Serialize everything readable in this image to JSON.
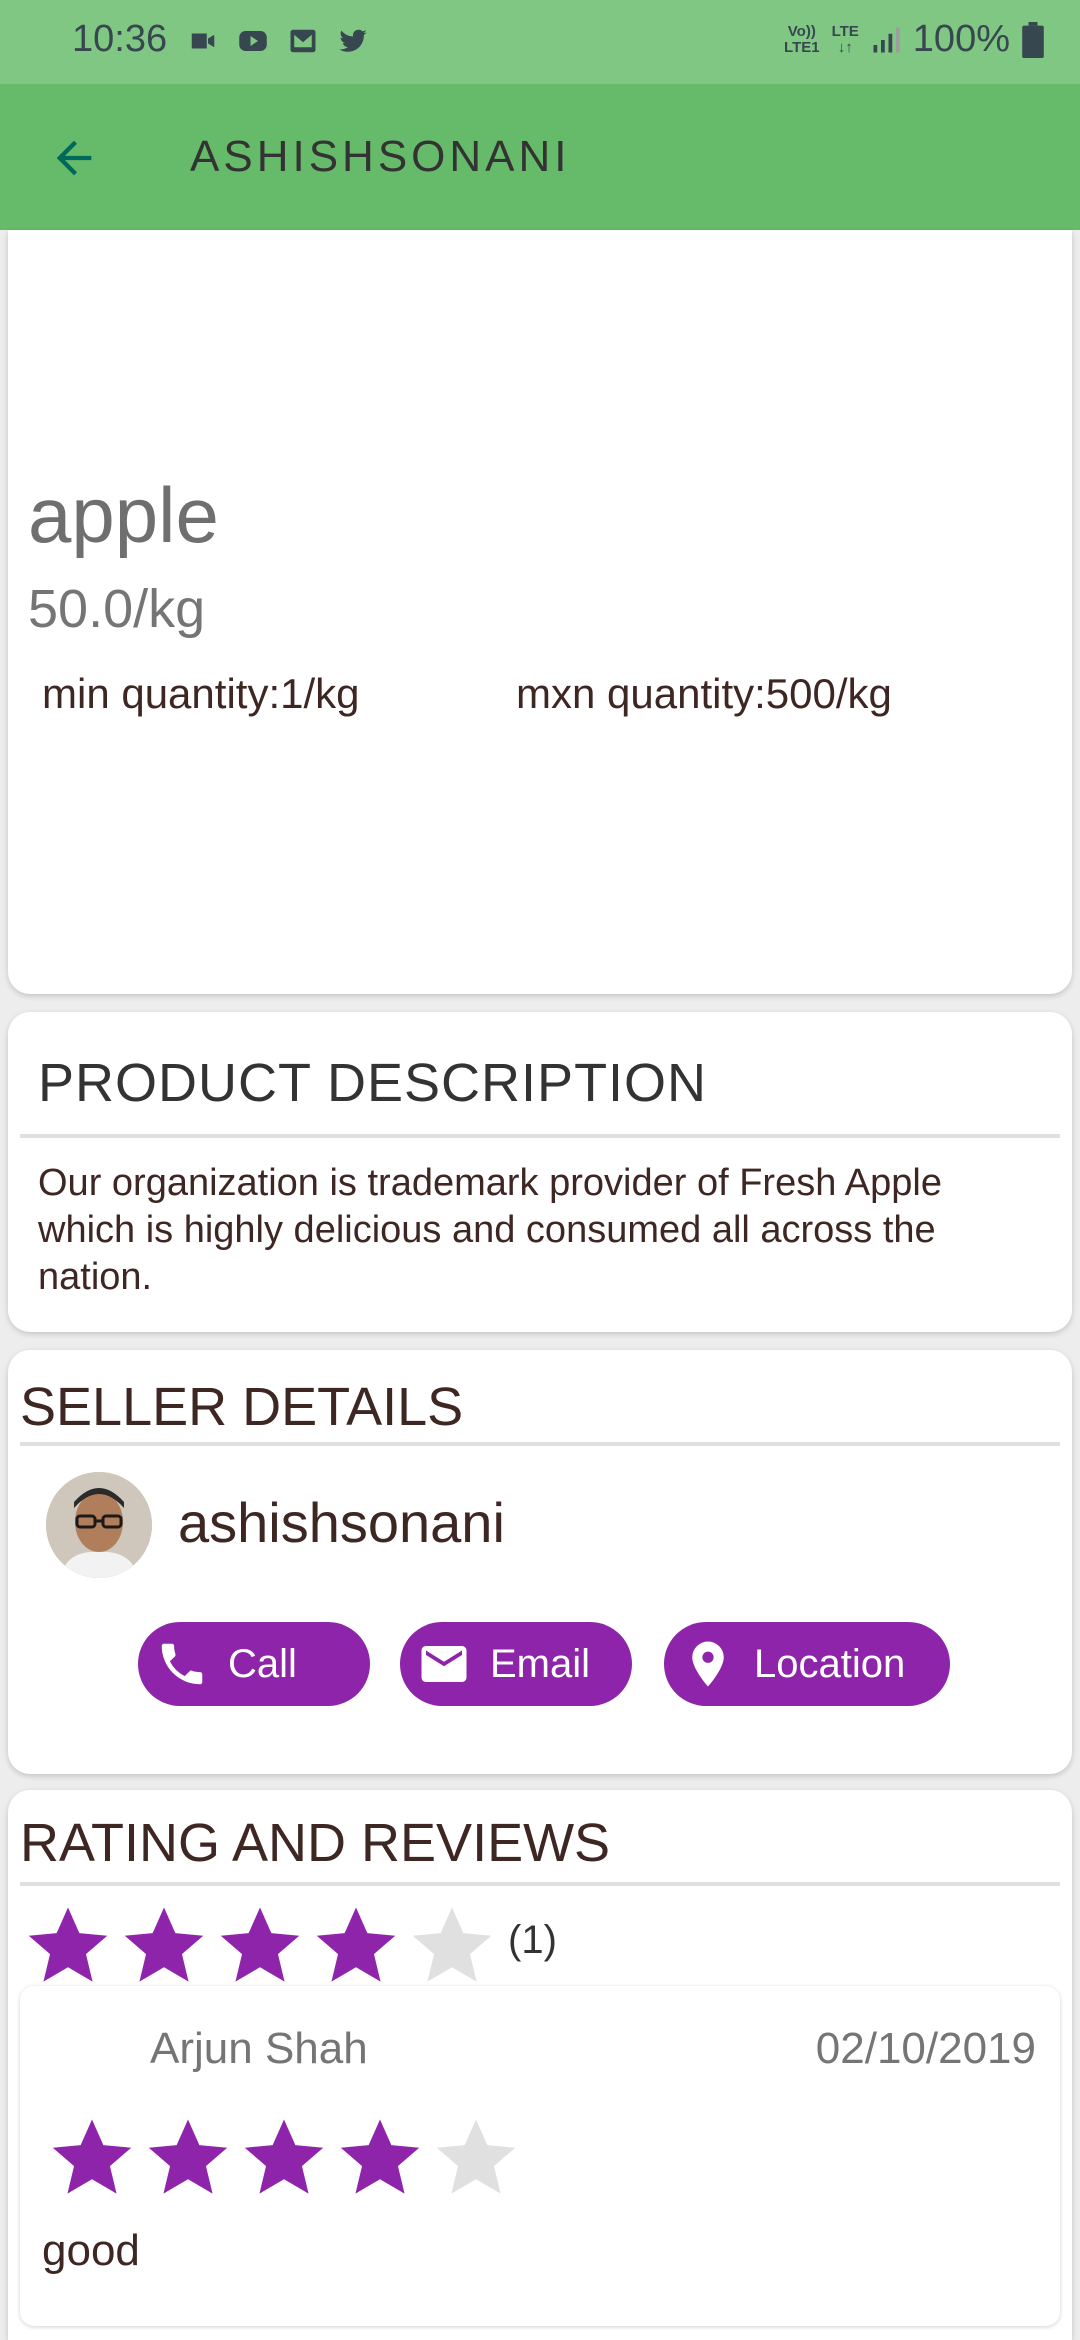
{
  "status_bar": {
    "time": "10:36",
    "battery_text": "100%",
    "network_label_1": "Vo))",
    "network_label_2": "LTE1",
    "network_label_3": "LTE"
  },
  "app_bar": {
    "title": "ASHISHSONANI",
    "back_icon": "arrow-back-icon"
  },
  "product": {
    "name": "apple",
    "price": "50.0/kg",
    "min_quantity": "min quantity:1/kg",
    "max_quantity": "mxn quantity:500/kg"
  },
  "description": {
    "title": "PRODUCT DESCRIPTION",
    "text": "Our organization is trademark provider of Fresh Apple which is highly delicious and consumed all across the nation."
  },
  "seller": {
    "title": "SELLER DETAILS",
    "name": "ashishsonani",
    "buttons": {
      "call": "Call",
      "email": "Email",
      "location": "Location"
    }
  },
  "rating": {
    "title": "RATING AND REVIEWS",
    "average_stars": 4,
    "max_stars": 5,
    "count": "(1)",
    "reviews": [
      {
        "name": "Arjun Shah",
        "date": "02/10/2019",
        "stars": 4,
        "text": "good"
      }
    ]
  },
  "colors": {
    "status_bar": "#81c784",
    "app_bar": "#66bb6a",
    "accent_purple": "#8e24aa",
    "star_filled": "#8e24aa",
    "star_empty": "#e0e0e0"
  }
}
